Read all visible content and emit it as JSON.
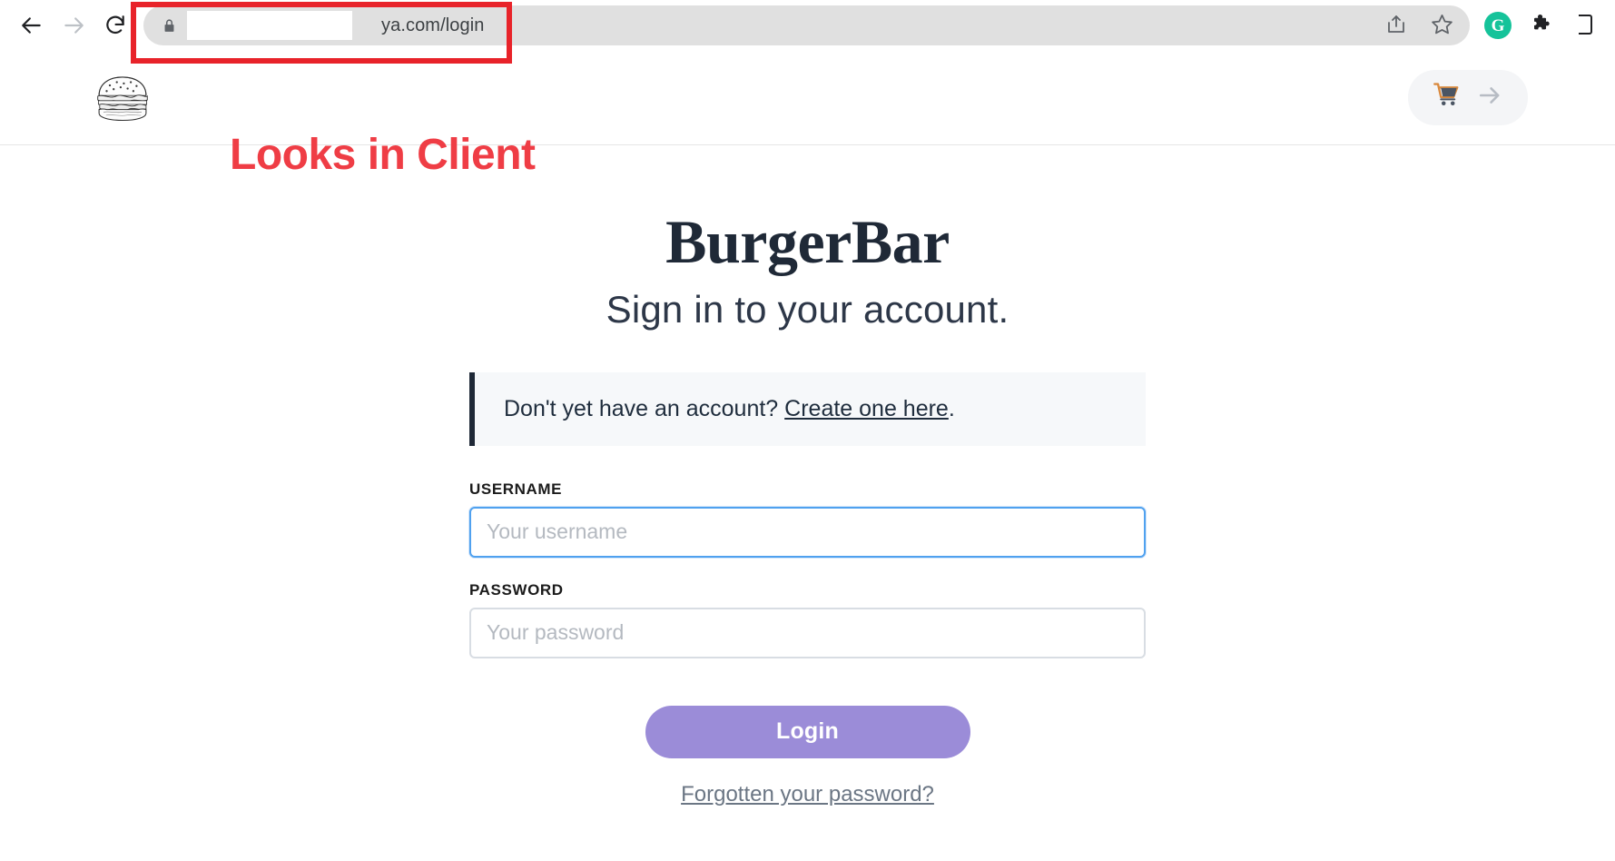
{
  "browser": {
    "back_icon": "arrow-left-icon",
    "forward_icon": "arrow-right-icon",
    "reload_icon": "reload-icon",
    "lock_icon": "lock-icon",
    "url": "ya.com/login",
    "share_icon": "share-icon",
    "bookmark_icon": "star-icon",
    "grammarly_label": "G",
    "extensions_icon": "puzzle-piece-icon",
    "menu_icon": "browser-menu-icon"
  },
  "annotation": {
    "text": "Looks in Client",
    "color": "#ef3d45",
    "box_color": "#e8232a"
  },
  "site_header": {
    "logo_icon": "burger-logo-icon",
    "cart_icon": "shopping-cart-icon",
    "cart_arrow_icon": "arrow-right-icon"
  },
  "main": {
    "brand_title": "BurgerBar",
    "subtitle": "Sign in to your account.",
    "alert": {
      "prefix": "Don't yet have an account? ",
      "link_label": "Create one here",
      "suffix": "."
    },
    "form": {
      "username_label": "USERNAME",
      "username_value": "",
      "username_placeholder": "Your username",
      "password_label": "PASSWORD",
      "password_value": "",
      "password_placeholder": "Your password",
      "login_button_label": "Login",
      "forgot_link_label": "Forgotten your password?"
    }
  },
  "colors": {
    "accent_purple": "#9b8cd8",
    "focus_blue": "#50a1ef",
    "brand_dark": "#1f2937",
    "annotation_red": "#ef3d45",
    "grammarly_green": "#15c39a"
  }
}
